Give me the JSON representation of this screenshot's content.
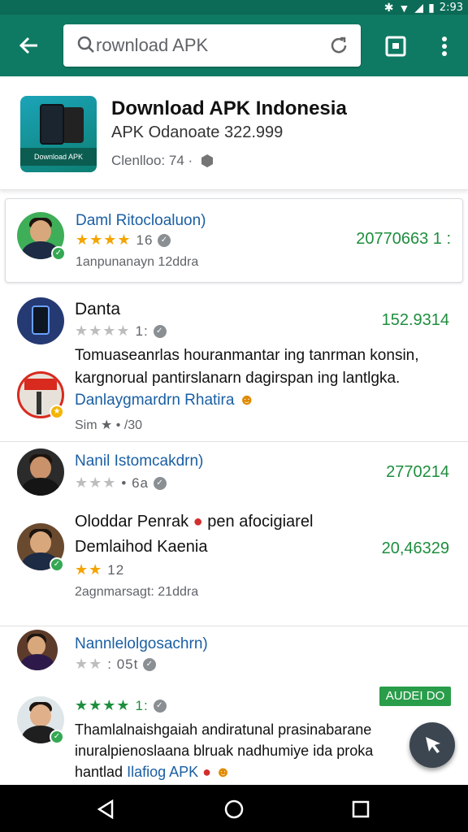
{
  "status": {
    "time": "2:93"
  },
  "search": {
    "value": "rownload APK",
    "placeholder": ""
  },
  "app": {
    "title": "Download APK Indonesia",
    "subtitle": "APK Odanoate 322.999",
    "meta": "Clenlloo:  74 ·",
    "icon_label": "Download APK"
  },
  "reviews": [
    {
      "name": "Daml Ritocloaluon)",
      "rating": 4,
      "count": "16",
      "when": "1anpunanayn 12ddra",
      "num": "20770663 1 :"
    },
    {
      "name": "Danta",
      "rating": 0,
      "count": "1:",
      "num": "152.9314",
      "body": "Tomuaseanrlas houranmantar ing tanrman konsin, kargnorual pantirslanarn dagirspan ing lantlgka."
    },
    {
      "name": "Danlaygmardrn Rhatira",
      "when": "Sim ★ • /30"
    },
    {
      "name": "Nanil Istomcakdrn)",
      "rating": 0,
      "count": "• 6a",
      "num": "2770214"
    },
    {
      "line1": "Oloddar Penrak",
      "line1b": "pen afocigiarel",
      "name": "Demlaihod Kaenia",
      "rating": 2,
      "count": "12",
      "when": "2agnmarsagt: 21ddra",
      "num": "20,46329"
    },
    {
      "name": "Nannlelolgosachrn)",
      "rating": 0,
      "count": ": 05t"
    },
    {
      "rating": 4,
      "count": "1:",
      "tag": "AUDEI DO",
      "body": "Thamlalnaishgaiah andiratunal prasinabarane inuralpienoslaana blruak nadhumiye ida proka",
      "body_tail": "hantlad",
      "link": "Ilafiog APK"
    }
  ]
}
